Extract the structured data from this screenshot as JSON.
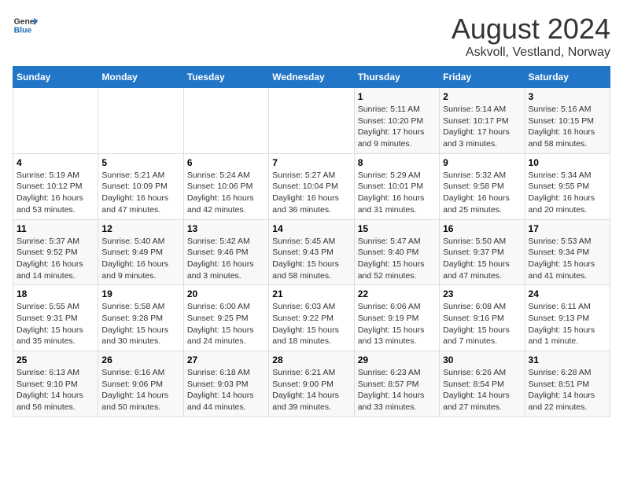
{
  "header": {
    "logo_line1": "General",
    "logo_line2": "Blue",
    "main_title": "August 2024",
    "subtitle": "Askvoll, Vestland, Norway"
  },
  "days_of_week": [
    "Sunday",
    "Monday",
    "Tuesday",
    "Wednesday",
    "Thursday",
    "Friday",
    "Saturday"
  ],
  "weeks": [
    [
      {
        "day": "",
        "content": ""
      },
      {
        "day": "",
        "content": ""
      },
      {
        "day": "",
        "content": ""
      },
      {
        "day": "",
        "content": ""
      },
      {
        "day": "1",
        "content": "Sunrise: 5:11 AM\nSunset: 10:20 PM\nDaylight: 17 hours\nand 9 minutes."
      },
      {
        "day": "2",
        "content": "Sunrise: 5:14 AM\nSunset: 10:17 PM\nDaylight: 17 hours\nand 3 minutes."
      },
      {
        "day": "3",
        "content": "Sunrise: 5:16 AM\nSunset: 10:15 PM\nDaylight: 16 hours\nand 58 minutes."
      }
    ],
    [
      {
        "day": "4",
        "content": "Sunrise: 5:19 AM\nSunset: 10:12 PM\nDaylight: 16 hours\nand 53 minutes."
      },
      {
        "day": "5",
        "content": "Sunrise: 5:21 AM\nSunset: 10:09 PM\nDaylight: 16 hours\nand 47 minutes."
      },
      {
        "day": "6",
        "content": "Sunrise: 5:24 AM\nSunset: 10:06 PM\nDaylight: 16 hours\nand 42 minutes."
      },
      {
        "day": "7",
        "content": "Sunrise: 5:27 AM\nSunset: 10:04 PM\nDaylight: 16 hours\nand 36 minutes."
      },
      {
        "day": "8",
        "content": "Sunrise: 5:29 AM\nSunset: 10:01 PM\nDaylight: 16 hours\nand 31 minutes."
      },
      {
        "day": "9",
        "content": "Sunrise: 5:32 AM\nSunset: 9:58 PM\nDaylight: 16 hours\nand 25 minutes."
      },
      {
        "day": "10",
        "content": "Sunrise: 5:34 AM\nSunset: 9:55 PM\nDaylight: 16 hours\nand 20 minutes."
      }
    ],
    [
      {
        "day": "11",
        "content": "Sunrise: 5:37 AM\nSunset: 9:52 PM\nDaylight: 16 hours\nand 14 minutes."
      },
      {
        "day": "12",
        "content": "Sunrise: 5:40 AM\nSunset: 9:49 PM\nDaylight: 16 hours\nand 9 minutes."
      },
      {
        "day": "13",
        "content": "Sunrise: 5:42 AM\nSunset: 9:46 PM\nDaylight: 16 hours\nand 3 minutes."
      },
      {
        "day": "14",
        "content": "Sunrise: 5:45 AM\nSunset: 9:43 PM\nDaylight: 15 hours\nand 58 minutes."
      },
      {
        "day": "15",
        "content": "Sunrise: 5:47 AM\nSunset: 9:40 PM\nDaylight: 15 hours\nand 52 minutes."
      },
      {
        "day": "16",
        "content": "Sunrise: 5:50 AM\nSunset: 9:37 PM\nDaylight: 15 hours\nand 47 minutes."
      },
      {
        "day": "17",
        "content": "Sunrise: 5:53 AM\nSunset: 9:34 PM\nDaylight: 15 hours\nand 41 minutes."
      }
    ],
    [
      {
        "day": "18",
        "content": "Sunrise: 5:55 AM\nSunset: 9:31 PM\nDaylight: 15 hours\nand 35 minutes."
      },
      {
        "day": "19",
        "content": "Sunrise: 5:58 AM\nSunset: 9:28 PM\nDaylight: 15 hours\nand 30 minutes."
      },
      {
        "day": "20",
        "content": "Sunrise: 6:00 AM\nSunset: 9:25 PM\nDaylight: 15 hours\nand 24 minutes."
      },
      {
        "day": "21",
        "content": "Sunrise: 6:03 AM\nSunset: 9:22 PM\nDaylight: 15 hours\nand 18 minutes."
      },
      {
        "day": "22",
        "content": "Sunrise: 6:06 AM\nSunset: 9:19 PM\nDaylight: 15 hours\nand 13 minutes."
      },
      {
        "day": "23",
        "content": "Sunrise: 6:08 AM\nSunset: 9:16 PM\nDaylight: 15 hours\nand 7 minutes."
      },
      {
        "day": "24",
        "content": "Sunrise: 6:11 AM\nSunset: 9:13 PM\nDaylight: 15 hours\nand 1 minute."
      }
    ],
    [
      {
        "day": "25",
        "content": "Sunrise: 6:13 AM\nSunset: 9:10 PM\nDaylight: 14 hours\nand 56 minutes."
      },
      {
        "day": "26",
        "content": "Sunrise: 6:16 AM\nSunset: 9:06 PM\nDaylight: 14 hours\nand 50 minutes."
      },
      {
        "day": "27",
        "content": "Sunrise: 6:18 AM\nSunset: 9:03 PM\nDaylight: 14 hours\nand 44 minutes."
      },
      {
        "day": "28",
        "content": "Sunrise: 6:21 AM\nSunset: 9:00 PM\nDaylight: 14 hours\nand 39 minutes."
      },
      {
        "day": "29",
        "content": "Sunrise: 6:23 AM\nSunset: 8:57 PM\nDaylight: 14 hours\nand 33 minutes."
      },
      {
        "day": "30",
        "content": "Sunrise: 6:26 AM\nSunset: 8:54 PM\nDaylight: 14 hours\nand 27 minutes."
      },
      {
        "day": "31",
        "content": "Sunrise: 6:28 AM\nSunset: 8:51 PM\nDaylight: 14 hours\nand 22 minutes."
      }
    ]
  ]
}
